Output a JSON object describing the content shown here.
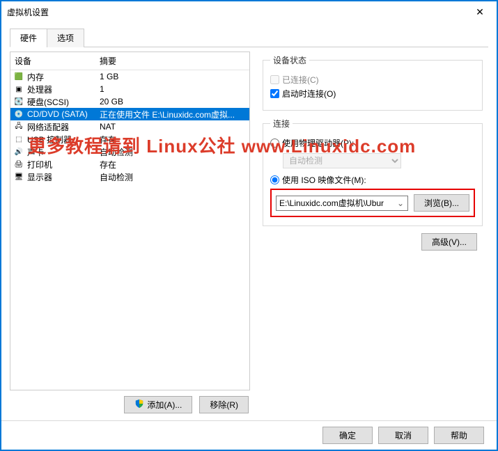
{
  "window": {
    "title": "虚拟机设置"
  },
  "tabs": {
    "hardware": "硬件",
    "options": "选项"
  },
  "list": {
    "header_device": "设备",
    "header_summary": "摘要",
    "rows": [
      {
        "icon": "🟩",
        "name": "内存",
        "summary": "1 GB"
      },
      {
        "icon": "▣",
        "name": "处理器",
        "summary": "1"
      },
      {
        "icon": "💽",
        "name": "硬盘(SCSI)",
        "summary": "20 GB"
      },
      {
        "icon": "💿",
        "name": "CD/DVD (SATA)",
        "summary": "正在使用文件 E:\\Linuxidc.com虚拟..."
      },
      {
        "icon": "🖧",
        "name": "网络适配器",
        "summary": "NAT"
      },
      {
        "icon": "⬚",
        "name": "USB 控制器",
        "summary": "存在"
      },
      {
        "icon": "🔊",
        "name": "声卡",
        "summary": "自动检测"
      },
      {
        "icon": "🖨",
        "name": "打印机",
        "summary": "存在"
      },
      {
        "icon": "🖥",
        "name": "显示器",
        "summary": "自动检测"
      }
    ],
    "add_button": "添加(A)...",
    "remove_button": "移除(R)"
  },
  "status": {
    "legend": "设备状态",
    "connected": "已连接(C)",
    "connect_on_start": "启动时连接(O)"
  },
  "connection": {
    "legend": "连接",
    "use_physical": "使用物理驱动器(P):",
    "physical_placeholder": "自动检测",
    "use_iso": "使用 ISO 映像文件(M):",
    "iso_value": "E:\\Linuxidc.com虚拟机\\Ubur",
    "browse": "浏览(B)..."
  },
  "advanced": "高级(V)...",
  "footer": {
    "ok": "确定",
    "cancel": "取消",
    "help": "帮助"
  },
  "watermark": "更多教程请到 Linux公社 www.Linuxidc.com"
}
